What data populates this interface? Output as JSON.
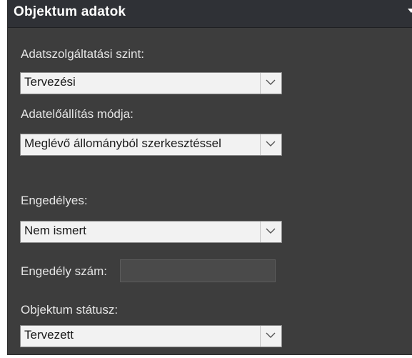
{
  "panel": {
    "title": "Objektum adatok"
  },
  "fields": {
    "service_level": {
      "label": "Adatszolgáltatási szint:",
      "value": "Tervezési"
    },
    "production_mode": {
      "label": "Adatelőállítás módja:",
      "value": "Meglévő állományból szerkesztéssel"
    },
    "licensed": {
      "label": "Engedélyes:",
      "value": "Nem ismert"
    },
    "license_number": {
      "label": "Engedély szám:",
      "value": ""
    },
    "object_status": {
      "label": "Objektum státusz:",
      "value": "Tervezett"
    }
  },
  "icons": {
    "collapse": "chevron-down-icon",
    "dropdown": "chevron-down-icon"
  },
  "colors": {
    "panel_bg": "#3d3d3d",
    "header_bg": "#2f3136",
    "label_text": "#e6e6e6",
    "select_bg": "#f2f2f2"
  }
}
